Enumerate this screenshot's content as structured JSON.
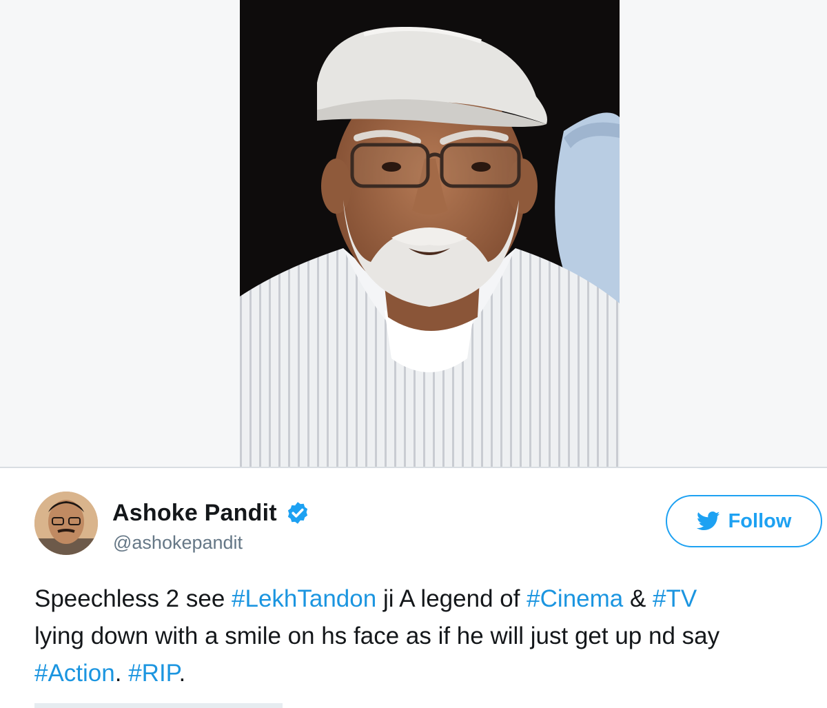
{
  "tweet": {
    "user": {
      "display_name": "Ashoke Pandit",
      "handle": "@ashokepandit",
      "verified": true
    },
    "follow_button": {
      "label": "Follow",
      "icon": "twitter-bird-icon"
    },
    "text_lines": [
      [
        {
          "type": "text",
          "value": "Speechless 2 see "
        },
        {
          "type": "hashtag",
          "value": "#LekhTandon"
        },
        {
          "type": "text",
          "value": " ji A legend of "
        },
        {
          "type": "hashtag",
          "value": "#Cinema"
        },
        {
          "type": "text",
          "value": " & "
        },
        {
          "type": "hashtag",
          "value": "#TV"
        }
      ],
      [
        {
          "type": "text",
          "value": "lying down with a smile on hs face as if he will just get up nd say"
        }
      ],
      [
        {
          "type": "hashtag",
          "value": "#Action"
        },
        {
          "type": "text",
          "value": ". "
        },
        {
          "type": "hashtag",
          "value": "#RIP"
        },
        {
          "type": "text",
          "value": "."
        }
      ]
    ]
  },
  "colors": {
    "accent": "#1da1f2",
    "hashtag": "#1b95e0",
    "handle": "#657786",
    "photo_background": "#0e0c0c"
  }
}
